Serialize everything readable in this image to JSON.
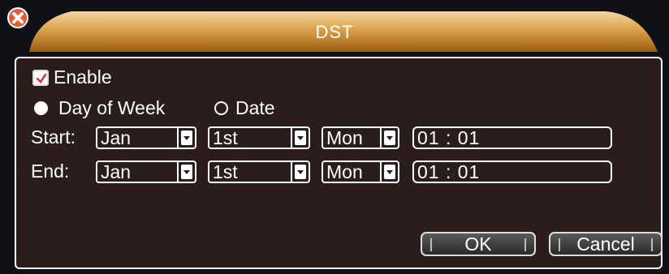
{
  "dialog": {
    "title": "DST"
  },
  "enable": {
    "label": "Enable",
    "checked": true
  },
  "mode": {
    "options": [
      "Day of Week",
      "Date"
    ],
    "selected": "Day of Week"
  },
  "start": {
    "label": "Start:",
    "month": "Jan",
    "week": "1st",
    "day": "Mon",
    "time": "01 : 01"
  },
  "end": {
    "label": "End:",
    "month": "Jan",
    "week": "1st",
    "day": "Mon",
    "time": "01 : 01"
  },
  "buttons": {
    "ok": "OK",
    "cancel": "Cancel"
  },
  "colors": {
    "panel": "#2b1d1b",
    "title_gradient_top": "#fff1c8",
    "title_gradient_bottom": "#b46d17",
    "close": "#e65a2d"
  }
}
